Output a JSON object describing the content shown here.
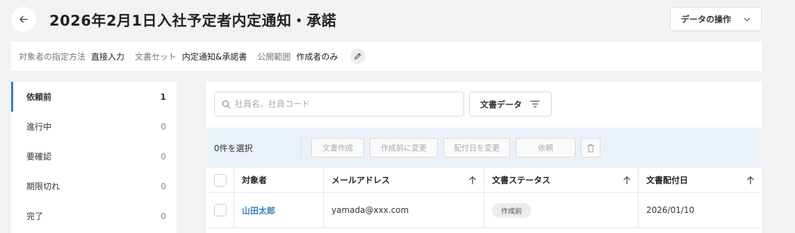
{
  "header": {
    "title": "2026年2月1日入社予定者内定通知・承諾",
    "data_ops_label": "データの操作"
  },
  "meta": {
    "target_method_key": "対象者の指定方法",
    "target_method_val": "直接入力",
    "doc_set_key": "文書セット",
    "doc_set_val": "内定通知&承諾書",
    "scope_key": "公開範囲",
    "scope_val": "作成者のみ"
  },
  "sidebar": {
    "items": [
      {
        "label": "依頼前",
        "count": "1"
      },
      {
        "label": "進行中",
        "count": "0"
      },
      {
        "label": "要確認",
        "count": "0"
      },
      {
        "label": "期限切れ",
        "count": "0"
      },
      {
        "label": "完了",
        "count": "0"
      }
    ]
  },
  "search": {
    "placeholder": "社員名、社員コード"
  },
  "filter": {
    "label": "文書データ"
  },
  "actions": {
    "selected_text": "0件を選択",
    "create_doc": "文書作成",
    "change_pre": "作成前に変更",
    "change_date": "配付日を変更",
    "request": "依頼"
  },
  "table": {
    "headers": [
      "対象者",
      "メールアドレス",
      "文書ステータス",
      "文書配付日"
    ],
    "rows": [
      {
        "name": "山田太郎",
        "email": "yamada@xxx.com",
        "status": "作成前",
        "date": "2026/01/10"
      }
    ]
  },
  "colors": {
    "accent": "#2f80c8",
    "action_bar_bg": "#eaf1f9"
  }
}
